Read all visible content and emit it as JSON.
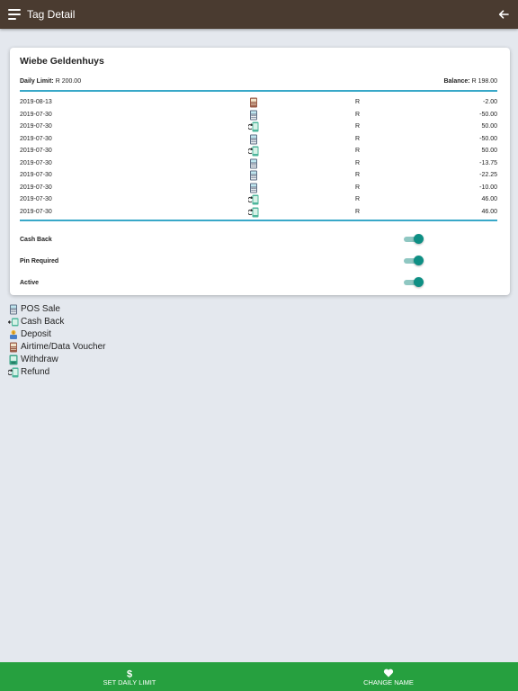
{
  "header": {
    "title": "Tag Detail",
    "menu_icon": "menu-icon",
    "back_icon": "arrow-left-icon"
  },
  "card": {
    "name": "Wiebe Geldenhuys",
    "daily_limit_label": "Daily Limit:",
    "daily_limit_value": "R 200.00",
    "balance_label": "Balance:",
    "balance_value": "R 198.00"
  },
  "transactions": [
    {
      "date": "2019-08-13",
      "icon": "airtime-data-voucher-icon",
      "currency": "R",
      "amount": "-2.00"
    },
    {
      "date": "2019-07-30",
      "icon": "pos-sale-icon",
      "currency": "R",
      "amount": "-50.00"
    },
    {
      "date": "2019-07-30",
      "icon": "refund-icon",
      "currency": "R",
      "amount": "50.00"
    },
    {
      "date": "2019-07-30",
      "icon": "pos-sale-icon",
      "currency": "R",
      "amount": "-50.00"
    },
    {
      "date": "2019-07-30",
      "icon": "refund-icon",
      "currency": "R",
      "amount": "50.00"
    },
    {
      "date": "2019-07-30",
      "icon": "pos-sale-icon",
      "currency": "R",
      "amount": "-13.75"
    },
    {
      "date": "2019-07-30",
      "icon": "pos-sale-icon",
      "currency": "R",
      "amount": "-22.25"
    },
    {
      "date": "2019-07-30",
      "icon": "pos-sale-icon",
      "currency": "R",
      "amount": "-10.00"
    },
    {
      "date": "2019-07-30",
      "icon": "refund-icon",
      "currency": "R",
      "amount": "46.00"
    },
    {
      "date": "2019-07-30",
      "icon": "refund-icon",
      "currency": "R",
      "amount": "46.00"
    }
  ],
  "settings": [
    {
      "label": "Cash Back",
      "on": true
    },
    {
      "label": "Pin Required",
      "on": true
    },
    {
      "label": "Active",
      "on": true
    }
  ],
  "legend": [
    {
      "label": "POS Sale",
      "icon": "pos-sale-icon"
    },
    {
      "label": "Cash Back",
      "icon": "cash-back-icon"
    },
    {
      "label": "Deposit",
      "icon": "deposit-icon"
    },
    {
      "label": "Airtime/Data Voucher",
      "icon": "airtime-data-voucher-icon"
    },
    {
      "label": "Withdraw",
      "icon": "withdraw-icon"
    },
    {
      "label": "Refund",
      "icon": "refund-icon"
    }
  ],
  "footer": {
    "set_daily_limit": {
      "label": "SET DAILY LIMIT",
      "icon": "dollar-icon"
    },
    "change_name": {
      "label": "CHANGE NAME",
      "icon": "heart-icon"
    }
  },
  "colors": {
    "header": "#4a3b30",
    "accent_rule": "#38a8c8",
    "toggle_on": "#0e8f84",
    "footer": "#26a03f",
    "background": "#e4e8ee"
  }
}
